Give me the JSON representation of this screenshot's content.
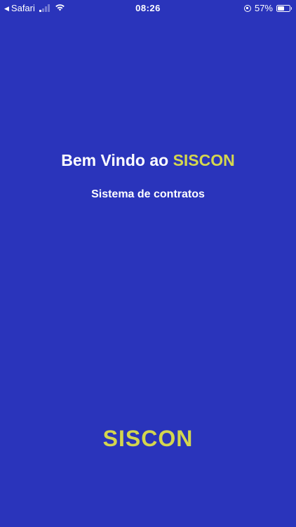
{
  "status_bar": {
    "carrier": "Safari",
    "time": "08:26",
    "battery_percent": "57%",
    "battery_level": 0.57,
    "icons": [
      "back-arrow-icon",
      "signal-icon",
      "wifi-icon",
      "orientation-lock-icon",
      "battery-icon"
    ]
  },
  "welcome": {
    "prefix": "Bem Vindo ao ",
    "brand": "SISCON"
  },
  "subtitle": "Sistema de contratos",
  "logo": "SISCON",
  "colors": {
    "background": "#2a34bb",
    "text": "#ffffff",
    "accent": "#d4d64e"
  }
}
